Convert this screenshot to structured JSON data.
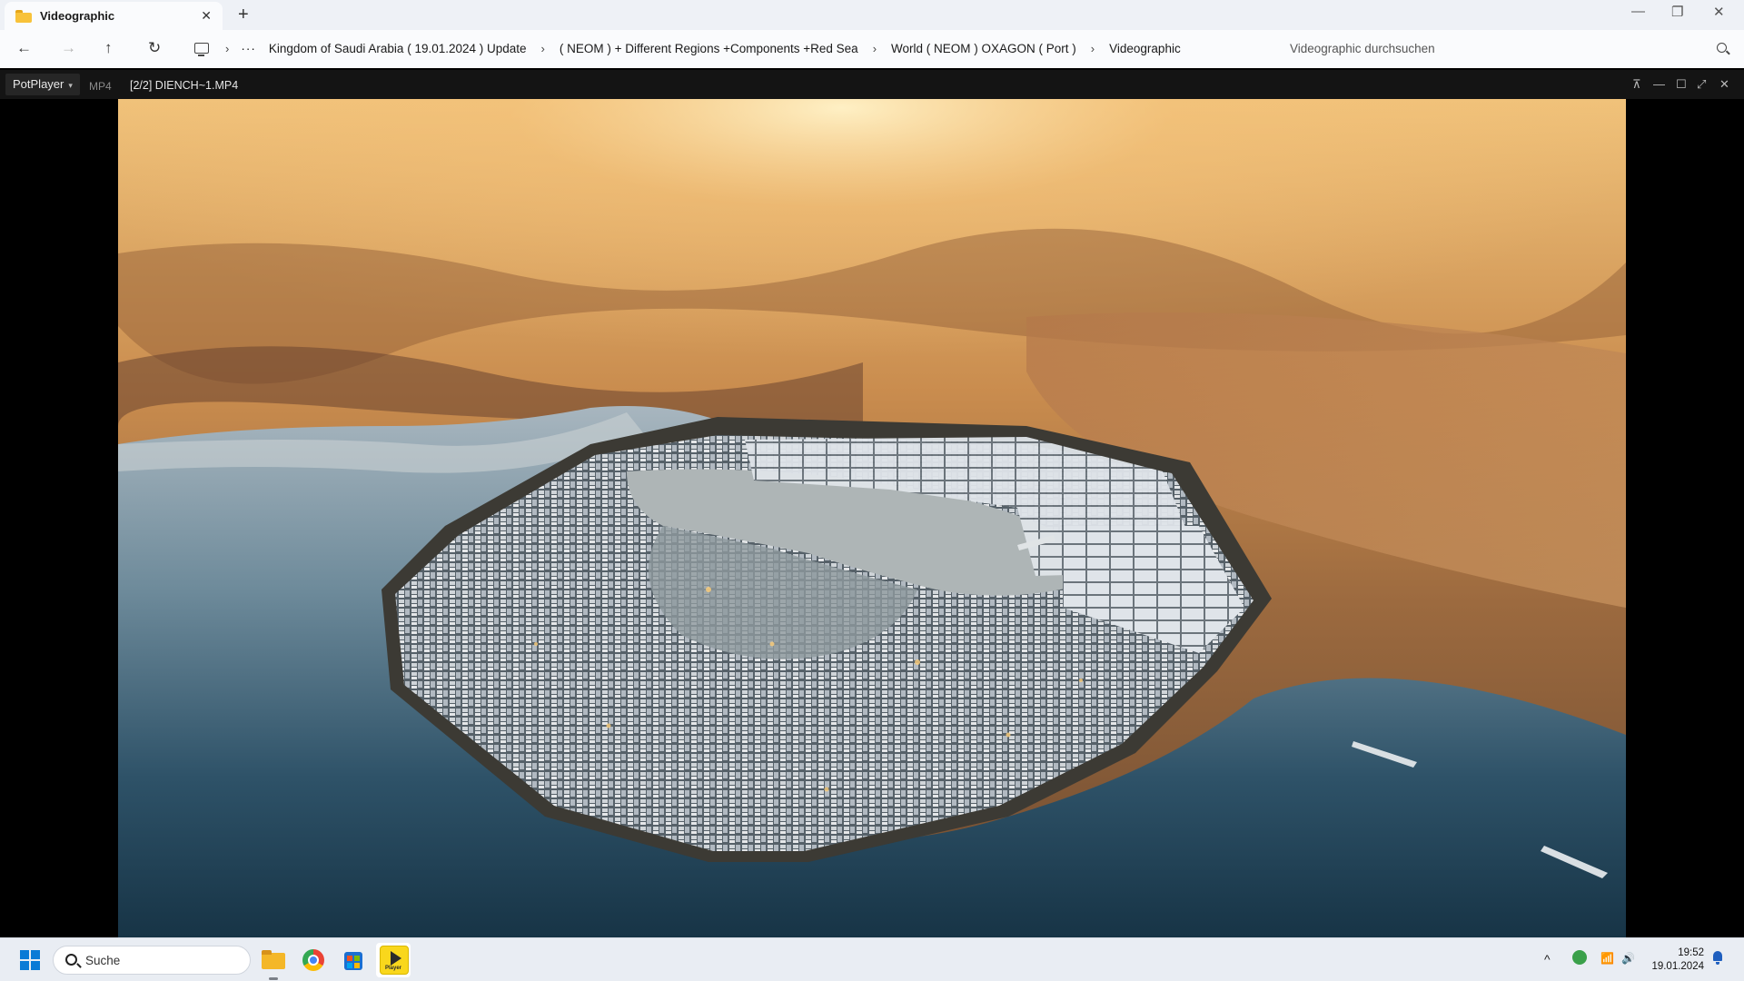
{
  "explorer": {
    "tab_title": "Videographic",
    "tab_close_glyph": "✕",
    "new_tab_glyph": "+",
    "window_controls": {
      "minimize": "—",
      "restore": "❐",
      "close": "✕"
    },
    "nav": {
      "back": "←",
      "forward": "→",
      "up": "↑",
      "refresh": "↻"
    },
    "overflow": "···",
    "breadcrumb_sep": "›",
    "breadcrumbs": [
      "Kingdom of Saudi Arabia ( 19.01.2024 ) Update",
      "( NEOM ) + Different Regions +Components +Red Sea",
      "World ( NEOM ) OXAGON ( Port )",
      "Videographic"
    ],
    "search_placeholder": "Videographic durchsuchen"
  },
  "player": {
    "brand": "PotPlayer",
    "brand_caret": "▾",
    "format": "MP4",
    "file": "[2/2] DIENCH~1.MP4",
    "controls": {
      "pin": "⊼",
      "minimize": "—",
      "maximize": "☐",
      "fullscreen": "⤢",
      "close": "✕"
    },
    "video_content": "Aerial rendering of an octagonal floating port city on the sea at sunset with desert mountains behind"
  },
  "taskbar": {
    "search_placeholder": "Suche",
    "apps": [
      "file-explorer",
      "chrome",
      "microsoft-store",
      "potplayer"
    ],
    "potplayer_label": "Player",
    "tray": {
      "chevron": "^",
      "wifi": "📶",
      "volume": "🔊"
    },
    "time": "19:52",
    "date": "19.01.2024"
  },
  "colors": {
    "accent": "#0a7bd6",
    "player_bar": "#141414",
    "explorer_bg": "#fafbfd"
  }
}
